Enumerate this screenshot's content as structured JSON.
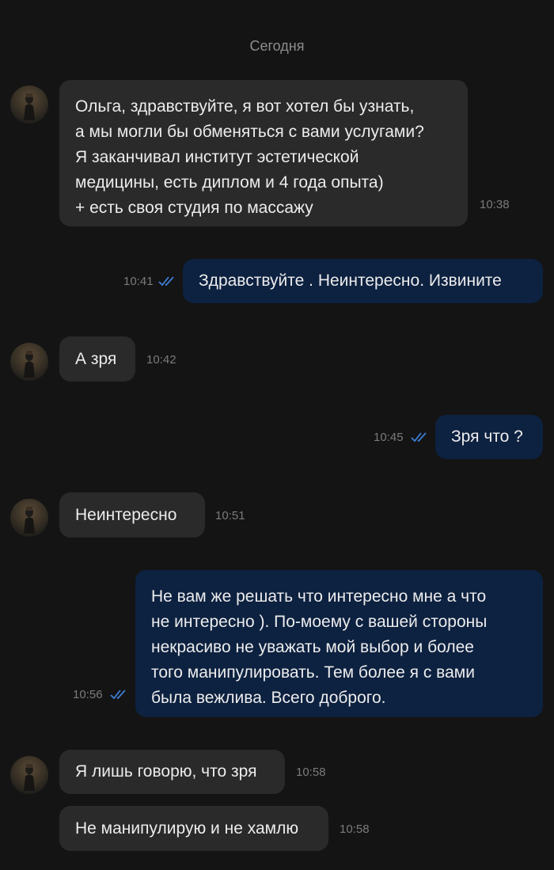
{
  "date_separator": "Сегодня",
  "messages": [
    {
      "lines": [
        "Ольга, здравствуйте, я вот хотел бы узнать,",
        "а мы могли бы обменяться с вами услугами?",
        "Я заканчивал институт эстетической",
        "медицины, есть диплом и 4 года опыта)",
        "+ есть своя студия по массажу"
      ],
      "time": "10:38"
    },
    {
      "text": "Здравствуйте . Неинтересно. Извините",
      "time": "10:41"
    },
    {
      "text": "А зря",
      "time": "10:42"
    },
    {
      "text": "Зря что ?",
      "time": "10:45"
    },
    {
      "text": "Неинтересно",
      "time": "10:51"
    },
    {
      "lines": [
        "Не вам же решать что интересно мне а что",
        "не интересно ). По-моему с вашей стороны",
        "некрасиво не уважать мой выбор и более",
        "того манипулировать. Тем более я с вами",
        "была вежлива. Всего доброго."
      ],
      "time": "10:56"
    },
    {
      "text": "Я лишь говорю, что зря",
      "time": "10:58"
    },
    {
      "text": "Не манипулирую и не хамлю",
      "time": "10:58"
    }
  ],
  "colors": {
    "background": "#141414",
    "incoming_bubble": "#2a2a2a",
    "outgoing_bubble": "#0d2140",
    "read_check": "#3d7fd6"
  },
  "icons": {
    "read_receipt": "double-check-icon",
    "avatar": "avatar"
  }
}
